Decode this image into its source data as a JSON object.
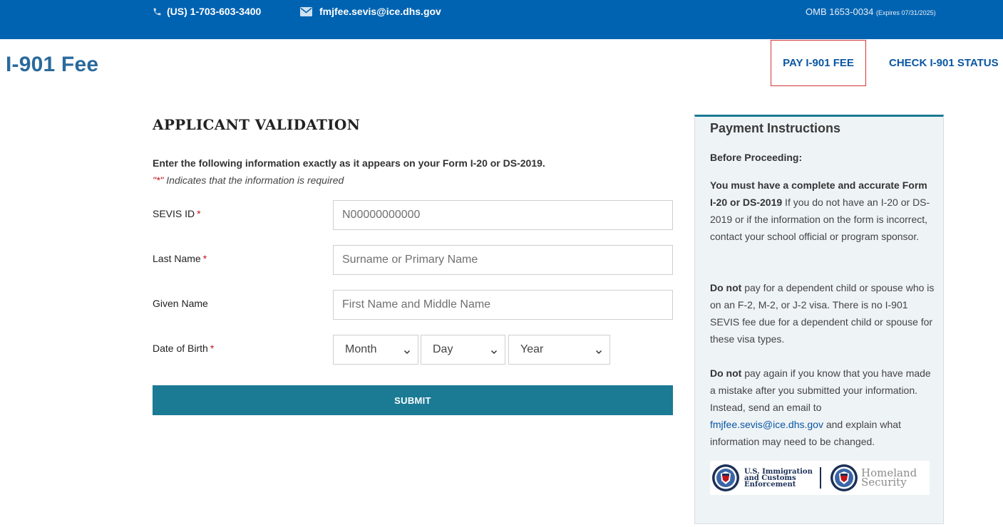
{
  "topbar": {
    "phone": "(US) 1-703-603-3400",
    "email": "fmjfee.sevis@ice.dhs.gov",
    "omb": "OMB 1653-0034",
    "omb_expires": "(Expires 07/31/2025)"
  },
  "header": {
    "brand": "I-901 Fee",
    "nav_pay": "PAY I-901 FEE",
    "nav_check": "CHECK I-901 STATUS"
  },
  "form": {
    "title": "APPLICANT VALIDATION",
    "intro": "Enter the following information exactly as it appears on your Form I-20 or DS-2019.",
    "required_note_star": "\"*\"",
    "required_note_text": " Indicates that the information is required",
    "sevis_label": "SEVIS ID",
    "sevis_placeholder": "N00000000000",
    "last_label": "Last Name",
    "last_placeholder": "Surname or Primary Name",
    "given_label": "Given Name",
    "given_placeholder": "First Name and Middle Name",
    "dob_label": "Date of Birth",
    "month": "Month",
    "day": "Day",
    "year": "Year",
    "required_star": "*",
    "submit": "SUBMIT"
  },
  "panel": {
    "title": "Payment Instructions",
    "before": "Before Proceeding:",
    "p1_bold": "You must have a complete and accurate Form I-20 or DS-2019",
    "p1_text": " If you do not have an I-20 or DS-2019 or if the information on the form is incorrect, contact your school official or program sponsor.",
    "p2_bold": "Do not",
    "p2_text": " pay for a dependent child or spouse who is on an F-2, M-2, or J-2 visa. There is no I-901 SEVIS fee due for a dependent child or spouse for these visa types.",
    "p3_bold": "Do not",
    "p3_text_a": " pay again if you know that you have made a mistake after you submitted your information. Instead, send an email to ",
    "p3_link": "fmjfee.sevis@ice.dhs.gov",
    "p3_text_b": " and explain what information may need to be changed."
  },
  "logos": {
    "ice_line1": "U.S. Immigration",
    "ice_line2": "and Customs",
    "ice_line3": "Enforcement",
    "hs_line1": "Homeland",
    "hs_line2": "Security"
  },
  "colors": {
    "topbar": "#0063b1",
    "accent": "#1b7b94",
    "link": "#0a56a3",
    "required": "#c0141b",
    "highlight_border": "#d0373a"
  },
  "icons": {
    "phone": "phone-icon",
    "email": "envelope-icon",
    "select": "chevron-down-icon",
    "seal": "dhs-seal-icon"
  }
}
